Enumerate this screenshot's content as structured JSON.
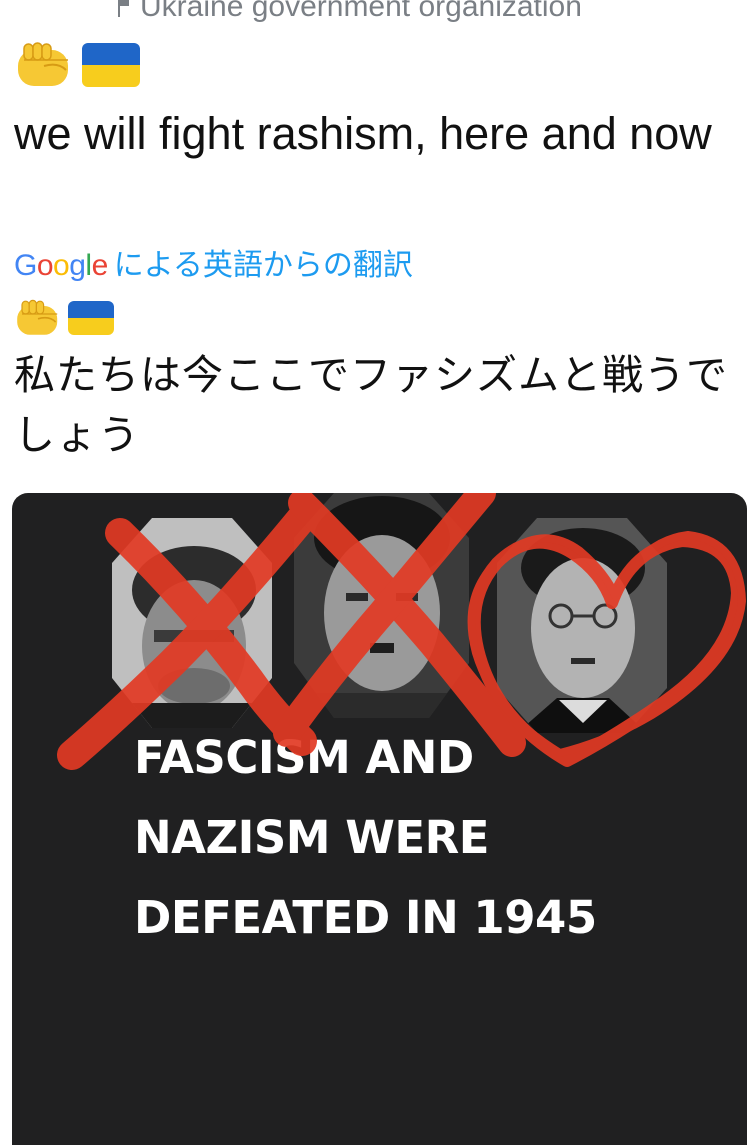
{
  "header": {
    "org_label": "Ukraine government organization",
    "flag_icon": "flag-icon"
  },
  "tweet": {
    "emoji_1": "raised-fist-emoji",
    "emoji_2": "ukraine-flag-emoji",
    "text": "we will fight rashism, here and now"
  },
  "translation": {
    "provider": "Google",
    "provider_letters": [
      "G",
      "o",
      "o",
      "g",
      "l",
      "e"
    ],
    "label": "による英語からの翻訳",
    "text": "私たちは今ここでファシズムと戦うでしょう"
  },
  "media": {
    "slogan_lines": [
      "FASCISM AND",
      "NAZISM WERE",
      "DEFEATED IN 1945"
    ]
  },
  "colors": {
    "translate_link": "#1d9bf0",
    "flag_blue": "#1f66c8",
    "flag_yellow": "#f7cd1d",
    "card_background": "#202021",
    "scribble_red": "#e23a24"
  }
}
